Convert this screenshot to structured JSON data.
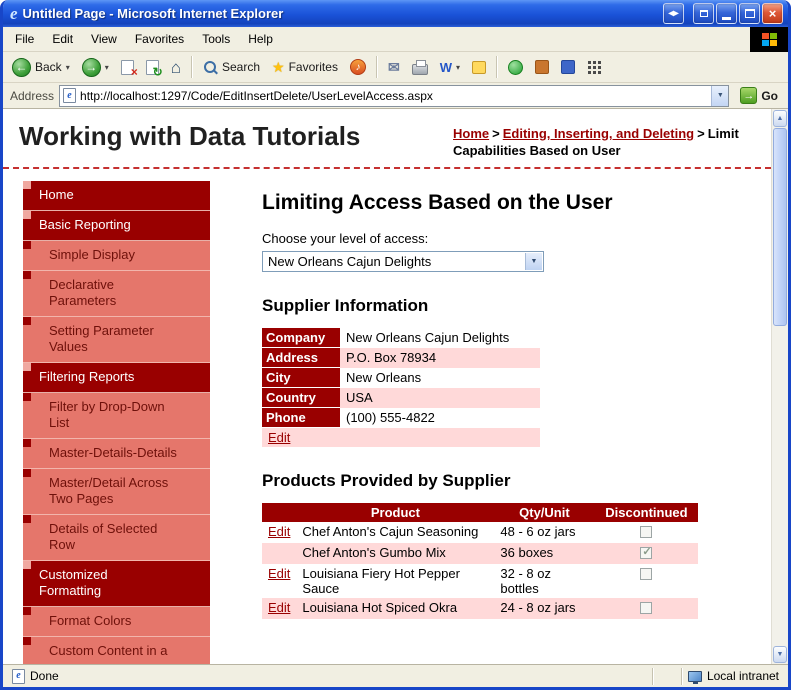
{
  "colors": {
    "dark_red": "#990000",
    "sub_item_red": "#E5766B",
    "row_pink": "#FFD9D9",
    "link_red": "#990000",
    "titlebar_blue": "#1A52D8"
  },
  "window": {
    "title": "Untitled Page - Microsoft Internet Explorer"
  },
  "menu": {
    "file": "File",
    "edit": "Edit",
    "view": "View",
    "favorites": "Favorites",
    "tools": "Tools",
    "help": "Help"
  },
  "toolbar": {
    "back_label": "Back",
    "search_label": "Search",
    "favorites_label": "Favorites"
  },
  "address": {
    "label": "Address",
    "url": "http://localhost:1297/Code/EditInsertDelete/UserLevelAccess.aspx",
    "go_label": "Go"
  },
  "statusbar": {
    "status": "Done",
    "zone": "Local intranet"
  },
  "header": {
    "site_title": "Working with Data Tutorials",
    "separator": ">",
    "crumbs": {
      "home": "Home",
      "section": "Editing, Inserting, and Deleting",
      "current": "Limit Capabilities Based on User"
    }
  },
  "sidebar": {
    "items": [
      {
        "label": "Home",
        "level": 0
      },
      {
        "label": "Basic Reporting",
        "level": 0
      },
      {
        "label": "Simple Display",
        "level": 1
      },
      {
        "label": "Declarative Parameters",
        "level": 1
      },
      {
        "label": "Setting Parameter Values",
        "level": 1
      },
      {
        "label": "Filtering Reports",
        "level": 0
      },
      {
        "label": "Filter by Drop-Down List",
        "level": 1
      },
      {
        "label": "Master-Details-Details",
        "level": 1
      },
      {
        "label": "Master/Detail Across Two Pages",
        "level": 1
      },
      {
        "label": "Details of Selected Row",
        "level": 1
      },
      {
        "label": "Customized Formatting",
        "level": 0
      },
      {
        "label": "Format Colors",
        "level": 1
      },
      {
        "label": "Custom Content in a",
        "level": 1
      }
    ]
  },
  "main": {
    "title": "Limiting Access Based on the User",
    "access_label": "Choose your level of access:",
    "access_value": "New Orleans Cajun Delights",
    "supplier": {
      "title": "Supplier Information",
      "edit_label": "Edit",
      "rows": [
        {
          "label": "Company",
          "value": "New Orleans Cajun Delights"
        },
        {
          "label": "Address",
          "value": "P.O. Box 78934"
        },
        {
          "label": "City",
          "value": "New Orleans"
        },
        {
          "label": "Country",
          "value": "USA"
        },
        {
          "label": "Phone",
          "value": "(100) 555-4822"
        }
      ]
    },
    "products": {
      "title": "Products Provided by Supplier",
      "headers": [
        "",
        "Product",
        "Qty/Unit",
        "Discontinued"
      ],
      "rows": [
        {
          "edit": "Edit",
          "product": "Chef Anton's Cajun Seasoning",
          "qty": "48 - 6 oz jars",
          "discontinued": false
        },
        {
          "edit": "",
          "product": "Chef Anton's Gumbo Mix",
          "qty": "36 boxes",
          "discontinued": true
        },
        {
          "edit": "Edit",
          "product": "Louisiana Fiery Hot Pepper Sauce",
          "qty": "32 - 8 oz bottles",
          "discontinued": false
        },
        {
          "edit": "Edit",
          "product": "Louisiana Hot Spiced Okra",
          "qty": "24 - 8 oz jars",
          "discontinued": false
        }
      ]
    }
  },
  "icons": {
    "ie_e": "e",
    "resize": "◂▸",
    "close": "×",
    "back": "←",
    "forward": "→",
    "chevron": "▾",
    "stop": "×",
    "refresh": "↻",
    "home": "⌂",
    "note": "♪",
    "mail": "✉",
    "word": "W",
    "go": "→",
    "dropdown": "▼",
    "scroll_up": "▲",
    "scroll_down": "▼"
  }
}
